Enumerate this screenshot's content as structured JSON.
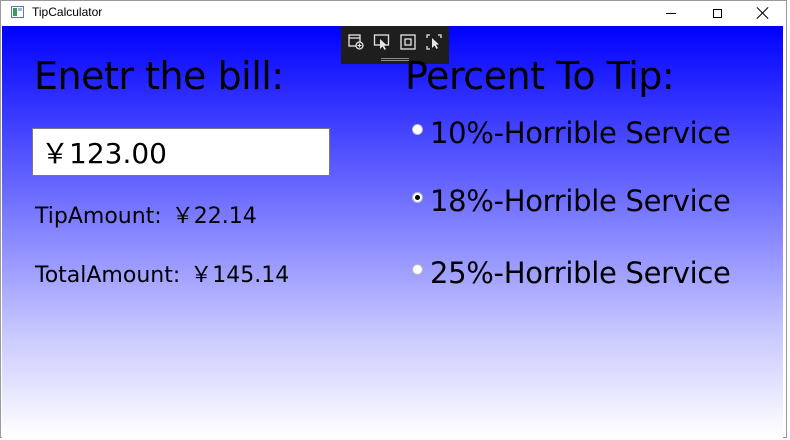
{
  "window": {
    "title": "TipCalculator"
  },
  "debug_toolbar": {
    "icons": [
      "live-visual-tree-icon",
      "select-element-icon",
      "display-layout-adorners-icon",
      "track-focused-element-icon"
    ]
  },
  "bill": {
    "heading": "Enetr the bill:",
    "input_value": "￥123.00"
  },
  "results": {
    "tip_label": "TipAmount:",
    "tip_value": "￥22.14",
    "total_label": "TotalAmount:",
    "total_value": "￥145.14"
  },
  "percent": {
    "heading": "Percent To Tip:",
    "options": [
      {
        "label": "10%-Horrible Service",
        "selected": false
      },
      {
        "label": "18%-Horrible Service",
        "selected": true
      },
      {
        "label": "25%-Horrible Service",
        "selected": false
      }
    ]
  },
  "colors": {
    "gradient_top": "#0000ff",
    "gradient_bottom": "#ffffff",
    "debug_toolbar_bg": "#1e1e1e"
  }
}
